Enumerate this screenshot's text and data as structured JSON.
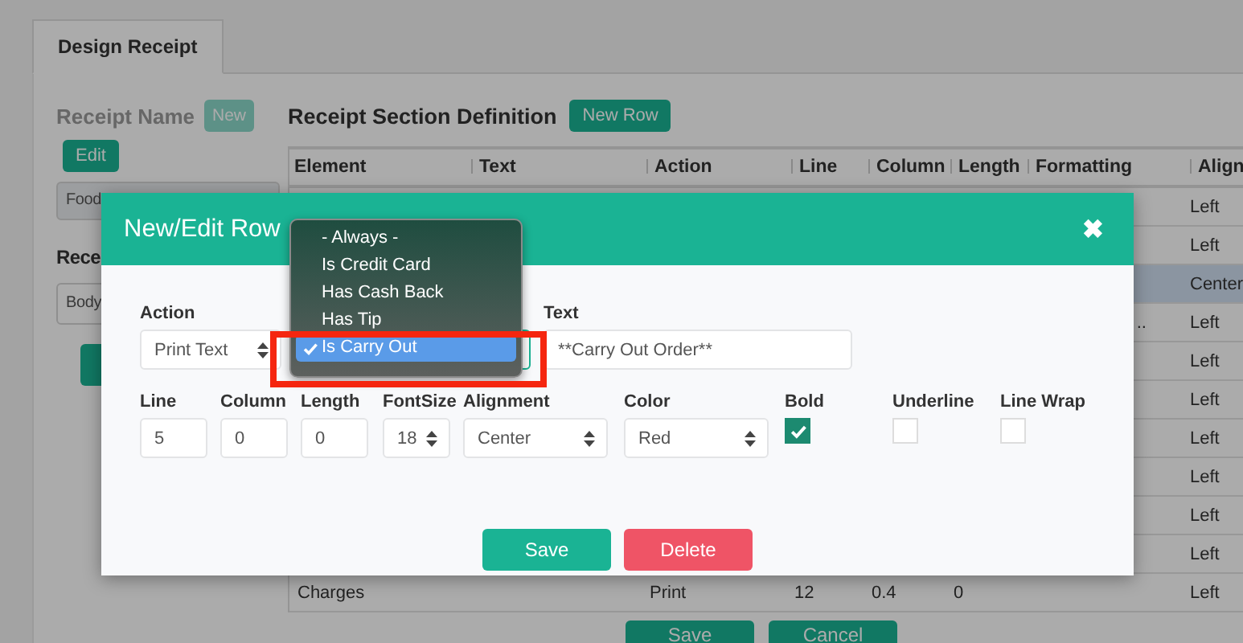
{
  "tabs": [
    {
      "label": "Design Receipt",
      "selected": true
    }
  ],
  "receipt_panel": {
    "title": "Receipt Name",
    "disabled": true,
    "new_button": "New",
    "edit_button": "Edit",
    "name_value": "Food",
    "section_title": "Rece",
    "section_value": "Body"
  },
  "section_definition": {
    "title": "Receipt Section Definition",
    "new_row_button": "New Row",
    "table": {
      "columns": [
        "Element",
        "Text",
        "Action",
        "Line",
        "Column",
        "Length",
        "Formatting",
        "Align"
      ],
      "rows": [
        {
          "align": "Left",
          "selected": false
        },
        {
          "align": "Left",
          "selected": false
        },
        {
          "align": "Center",
          "selected": true
        },
        {
          "formatting": "..",
          "align": "Left",
          "selected": false
        },
        {
          "align": "Left",
          "selected": false
        },
        {
          "align": "Left",
          "selected": false
        },
        {
          "align": "Left",
          "selected": false
        },
        {
          "align": "Left",
          "selected": false
        },
        {
          "align": "Left",
          "selected": false
        },
        {
          "align": "Left",
          "selected": false
        },
        {
          "element": "Charges",
          "action": "Print",
          "line": "12",
          "column": "0.4",
          "length": "0",
          "align": "Left",
          "selected": false
        }
      ]
    },
    "buttons": [
      "Save",
      "Cancel"
    ]
  },
  "dialog": {
    "title": "New/Edit Row",
    "close": "✖",
    "action": {
      "label": "Action",
      "value": "Print Text"
    },
    "condition": {
      "focused": true,
      "highlighted": true,
      "options": [
        {
          "label": "- Always -",
          "selected": false
        },
        {
          "label": "Is Credit Card",
          "selected": false
        },
        {
          "label": "Has Cash Back",
          "selected": false
        },
        {
          "label": "Has Tip",
          "selected": false
        },
        {
          "label": "Is Carry Out",
          "selected": true
        }
      ]
    },
    "text": {
      "label": "Text",
      "value": "**Carry Out Order**"
    },
    "fields": [
      {
        "kind": "input",
        "label": "Line",
        "value": "5"
      },
      {
        "kind": "input",
        "label": "Column",
        "value": "0"
      },
      {
        "kind": "input",
        "label": "Length",
        "value": "0"
      },
      {
        "kind": "select",
        "label": "FontSize",
        "value": "18"
      },
      {
        "kind": "select",
        "label": "Alignment",
        "value": "Center"
      },
      {
        "kind": "select",
        "label": "Color",
        "value": "Red"
      },
      {
        "kind": "checkbox",
        "label": "Bold",
        "checked": true
      },
      {
        "kind": "checkbox",
        "label": "Underline",
        "checked": false
      },
      {
        "kind": "checkbox",
        "label": "Line Wrap",
        "checked": false
      }
    ],
    "buttons": [
      {
        "kind": "primary",
        "label": "Save"
      },
      {
        "kind": "danger",
        "label": "Delete"
      }
    ]
  }
}
